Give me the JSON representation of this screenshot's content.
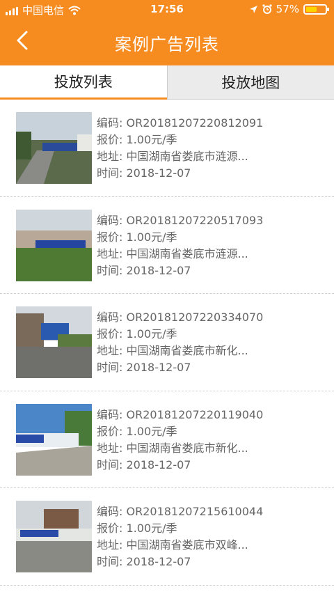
{
  "status_bar": {
    "carrier": "中国电信",
    "time": "17:56",
    "battery": "57%",
    "battery_level": 0.57
  },
  "header": {
    "title": "案例广告列表"
  },
  "tabs": [
    {
      "label": "投放列表",
      "active": true
    },
    {
      "label": "投放地图",
      "active": false
    }
  ],
  "field_labels": {
    "code": "编码:",
    "price": "报价:",
    "address": "地址:",
    "time": "时间:"
  },
  "items": [
    {
      "code": "OR20181207220812091",
      "price": "1.00元/季",
      "address": "中国湖南省娄底市涟源...",
      "date": "2018-12-07"
    },
    {
      "code": "OR20181207220517093",
      "price": "1.00元/季",
      "address": "中国湖南省娄底市涟源...",
      "date": "2018-12-07"
    },
    {
      "code": "OR20181207220334070",
      "price": "1.00元/季",
      "address": "中国湖南省娄底市新化...",
      "date": "2018-12-07"
    },
    {
      "code": "OR20181207220119040",
      "price": "1.00元/季",
      "address": "中国湖南省娄底市新化...",
      "date": "2018-12-07"
    },
    {
      "code": "OR20181207215610044",
      "price": "1.00元/季",
      "address": "中国湖南省娄底市双峰...",
      "date": "2018-12-07"
    }
  ],
  "colors": {
    "accent": "#f68b1f",
    "battery": "#ffd400"
  }
}
